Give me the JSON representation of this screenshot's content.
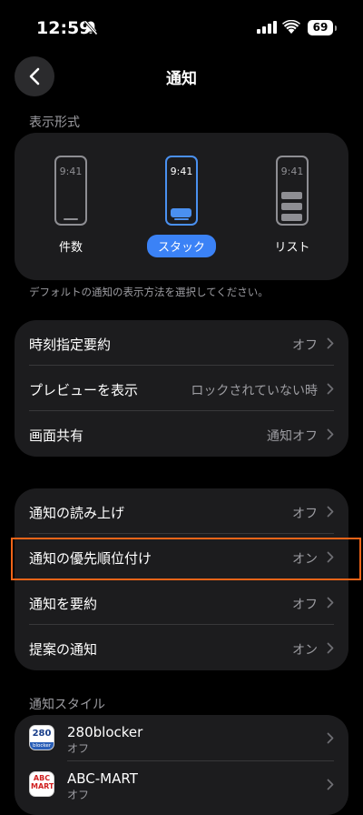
{
  "status": {
    "time": "12:59",
    "battery": "69"
  },
  "nav": {
    "title": "通知"
  },
  "display_style": {
    "section_label": "表示形式",
    "phone_time": "9:41",
    "options": [
      {
        "label": "件数",
        "selected": false
      },
      {
        "label": "スタック",
        "selected": true
      },
      {
        "label": "リスト",
        "selected": false
      }
    ],
    "caption": "デフォルトの通知の表示方法を選択してください。"
  },
  "group1": [
    {
      "label": "時刻指定要約",
      "value": "オフ"
    },
    {
      "label": "プレビューを表示",
      "value": "ロックされていない時"
    },
    {
      "label": "画面共有",
      "value": "通知オフ"
    }
  ],
  "group2": [
    {
      "label": "通知の読み上げ",
      "value": "オフ"
    },
    {
      "label": "通知の優先順位付け",
      "value": "オン"
    },
    {
      "label": "通知を要約",
      "value": "オフ"
    },
    {
      "label": "提案の通知",
      "value": "オン"
    }
  ],
  "notification_style": {
    "section_label": "通知スタイル",
    "apps": [
      {
        "name": "280blocker",
        "subtitle": "オフ",
        "icon_text": "280",
        "icon_sub": "blocker"
      },
      {
        "name": "ABC-MART",
        "subtitle": "オフ",
        "icon_text": "ABC MART"
      }
    ]
  },
  "colors": {
    "accent": "#3b82f6",
    "highlight": "#f06418",
    "card": "#1c1c1e"
  }
}
